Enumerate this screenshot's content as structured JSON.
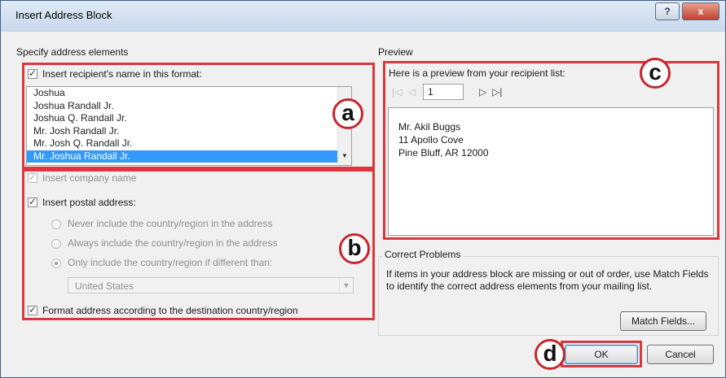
{
  "window": {
    "title": "Insert Address Block",
    "help_label": "?",
    "close_label": "x"
  },
  "specify": {
    "section_label": "Specify address elements",
    "recipient_name_label": "Insert recipient's name in this format:",
    "name_formats": [
      "Joshua",
      "Joshua Randall Jr.",
      "Joshua Q. Randall Jr.",
      "Mr. Josh Randall Jr.",
      "Mr. Josh Q. Randall Jr.",
      "Mr. Joshua Randall Jr."
    ],
    "selected_format": "Mr. Joshua Randall Jr.",
    "company_label": "Insert company name",
    "postal_label": "Insert postal address:",
    "country_options": [
      "Never include the country/region in the address",
      "Always include the country/region in the address",
      "Only include the country/region if different than:"
    ],
    "country_value": "United States",
    "format_label": "Format address according to the destination country/region"
  },
  "preview": {
    "section_label": "Preview",
    "intro": "Here is a preview from your recipient list:",
    "record_value": "1",
    "address_lines": [
      "Mr. Akil Buggs",
      "11 Apollo Cove",
      "Pine Bluff, AR 12000"
    ]
  },
  "correct": {
    "section_label": "Correct Problems",
    "text": "If items in your address block are missing or out of order, use Match Fields to identify the correct address elements from your mailing list.",
    "match_button": "Match Fields..."
  },
  "buttons": {
    "ok": "OK",
    "cancel": "Cancel"
  },
  "callouts": {
    "a": "a",
    "b": "b",
    "c": "c",
    "d": "d"
  },
  "colors": {
    "highlight": "#d9393e",
    "selection": "#3399ff"
  }
}
